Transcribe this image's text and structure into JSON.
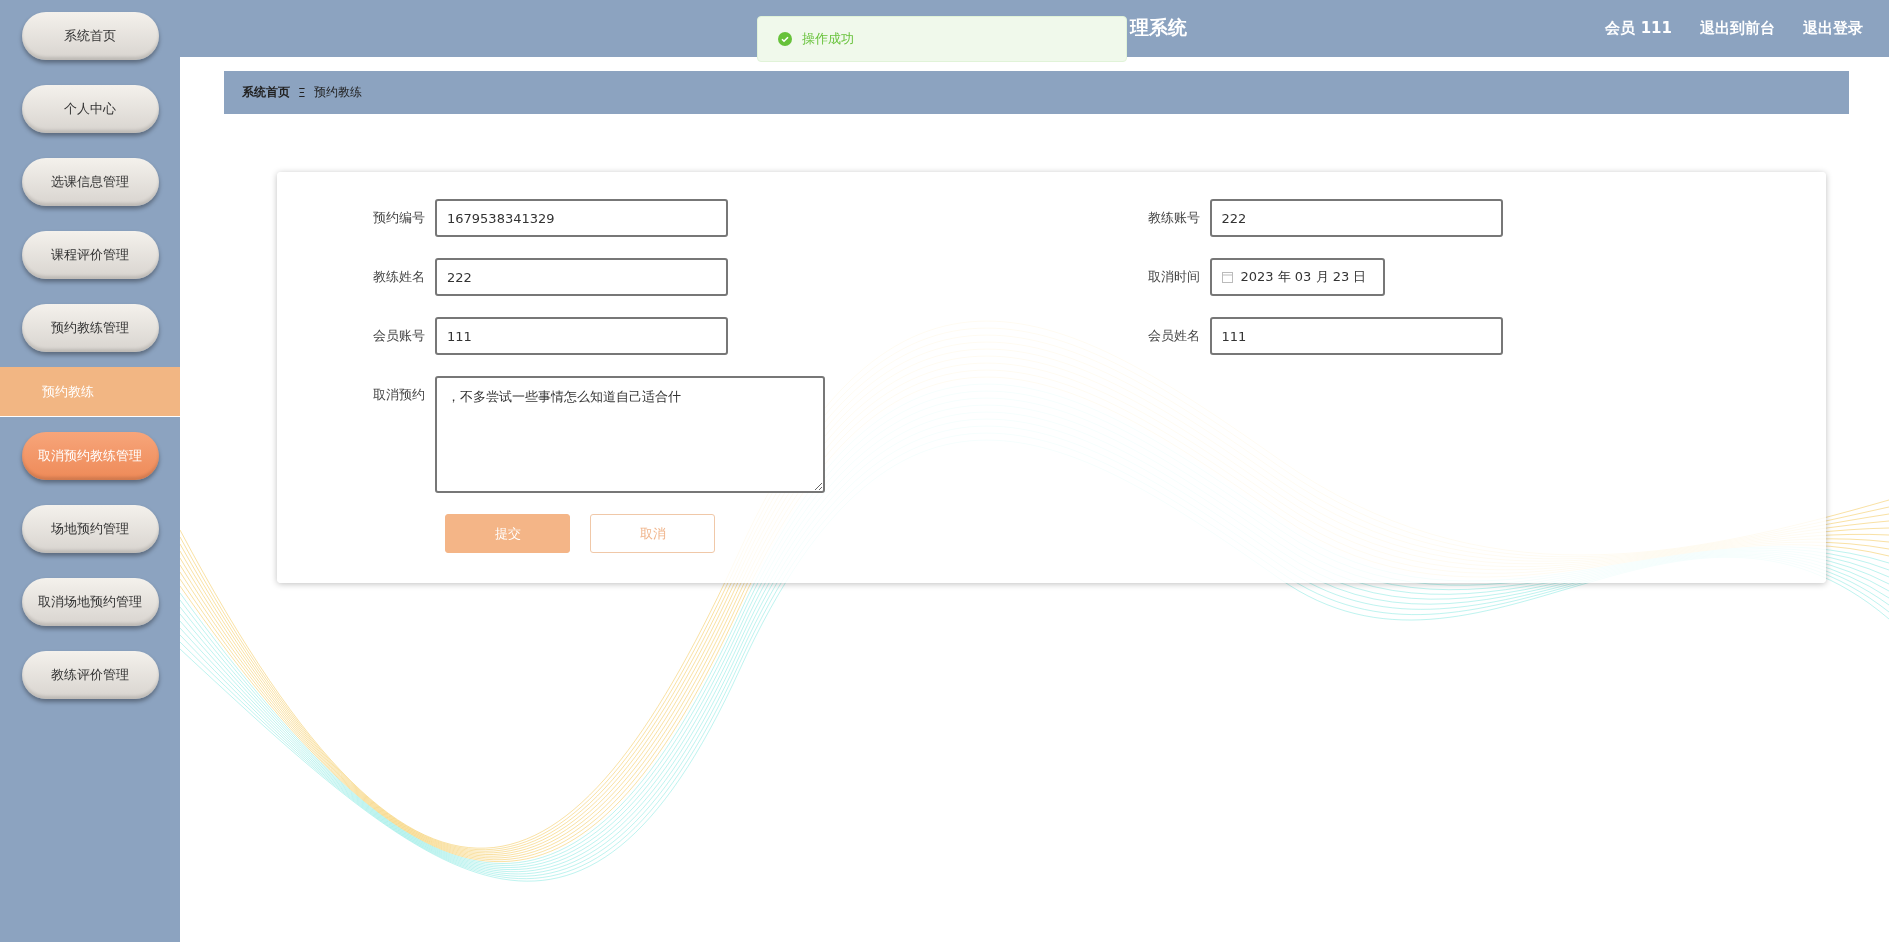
{
  "sidebar": {
    "items": [
      {
        "label": "系统首页",
        "selected": false
      },
      {
        "label": "个人中心",
        "selected": false
      },
      {
        "label": "选课信息管理",
        "selected": false
      },
      {
        "label": "课程评价管理",
        "selected": false
      },
      {
        "label": "预约教练管理",
        "selected": false,
        "children": [
          {
            "label": "预约教练",
            "selected": true
          }
        ]
      },
      {
        "label": "取消预约教练管理",
        "selected": true
      },
      {
        "label": "场地预约管理",
        "selected": false
      },
      {
        "label": "取消场地预约管理",
        "selected": false
      },
      {
        "label": "教练评价管理",
        "selected": false
      }
    ]
  },
  "header": {
    "title": "理系统",
    "user": "会员 111",
    "links": [
      "退出到前台",
      "退出登录"
    ]
  },
  "toast": {
    "message": "操作成功"
  },
  "breadcrumb": {
    "items": [
      "系统首页",
      "预约教练"
    ],
    "separator": "Ξ"
  },
  "form": {
    "fields": [
      {
        "label": "预约编号",
        "value": "1679538341329",
        "kind": "text"
      },
      {
        "label": "教练账号",
        "value": "222",
        "kind": "text"
      },
      {
        "label": "教练姓名",
        "value": "222",
        "kind": "text"
      },
      {
        "label": "取消时间",
        "value": "2023 年 03 月 23 日",
        "kind": "date"
      },
      {
        "label": "会员账号",
        "value": "111",
        "kind": "text"
      },
      {
        "label": "会员姓名",
        "value": "111",
        "kind": "text"
      },
      {
        "label": "取消预约",
        "value": "，不多尝试一些事情怎么知道自己适合什",
        "kind": "textarea"
      }
    ],
    "buttons": [
      {
        "label": "提交",
        "kind": "primary"
      },
      {
        "label": "取消",
        "kind": "secondary"
      }
    ]
  }
}
